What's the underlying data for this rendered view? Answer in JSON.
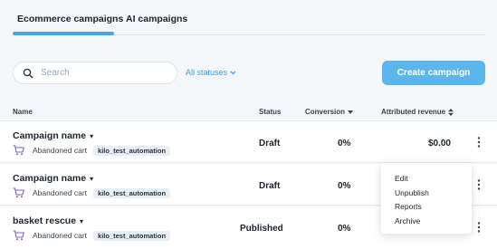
{
  "tabs": [
    {
      "label": "Ecommerce campaigns",
      "active": true
    },
    {
      "label": "AI campaigns",
      "active": false
    }
  ],
  "search": {
    "placeholder": "Search",
    "value": ""
  },
  "status_filter": {
    "label": "All statuses"
  },
  "create_button": {
    "label": "Create campaign"
  },
  "table": {
    "headers": {
      "name": "Name",
      "status": "Status",
      "conversion": "Conversion",
      "revenue": "Attributed revenue"
    },
    "rows": [
      {
        "name": "Campaign name",
        "type": "Abandoned cart",
        "tag": "kilo_test_automation",
        "status": "Draft",
        "conversion": "0%",
        "revenue": "$0.00"
      },
      {
        "name": "Campaign name",
        "type": "Abandoned cart",
        "tag": "kilo_test_automation",
        "status": "Draft",
        "conversion": "0%",
        "revenue": ""
      },
      {
        "name": "basket rescue",
        "type": "Abandoned cart",
        "tag": "kilo_test_automation",
        "status": "Published",
        "conversion": "0%",
        "revenue": ""
      }
    ]
  },
  "context_menu": {
    "items": [
      "Edit",
      "Unpublish",
      "Reports",
      "Archive"
    ]
  },
  "colors": {
    "accent": "#5bb6ee",
    "link": "#3a9ee0",
    "tab_underline": "#4da3e0",
    "cart_icon": "#7b5fd6"
  }
}
